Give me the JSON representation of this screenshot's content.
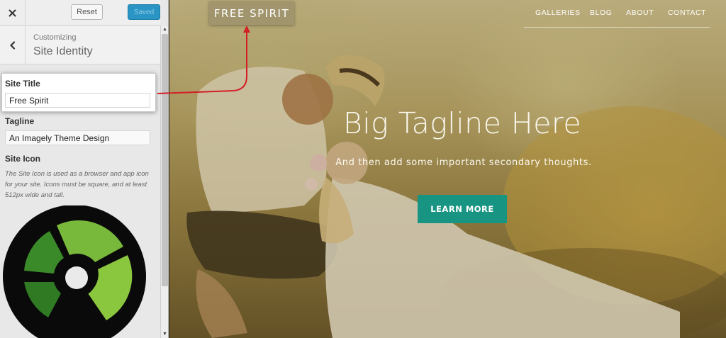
{
  "panel": {
    "close_icon": "close-icon",
    "reset_label": "Reset",
    "save_label": "Saved",
    "back_icon": "chevron-left-icon",
    "breadcrumb": "Customizing",
    "section_title": "Site Identity",
    "site_title_label": "Site Title",
    "site_title_value": "Free Spirit",
    "tagline_label": "Tagline",
    "tagline_value": "An Imagely Theme Design",
    "site_icon_label": "Site Icon",
    "site_icon_description": "The Site Icon is used as a browser and app icon for your site. Icons must be square, and at least 512px wide and tall.",
    "site_icon_image": "imagely-logo-icon"
  },
  "preview": {
    "brand": "FREE SPIRIT",
    "nav": [
      "GALLERIES",
      "BLOG",
      "ABOUT",
      "CONTACT"
    ],
    "headline": "Big Tagline Here",
    "subheadline": "And then add some important secondary thoughts.",
    "cta_label": "LEARN MORE"
  },
  "colors": {
    "accent_blue": "#2a95c5",
    "cta_teal": "#179582",
    "annotation_red": "#d21f26",
    "icon_green_light": "#8bc63f",
    "icon_green_dark": "#3b8a2a"
  }
}
